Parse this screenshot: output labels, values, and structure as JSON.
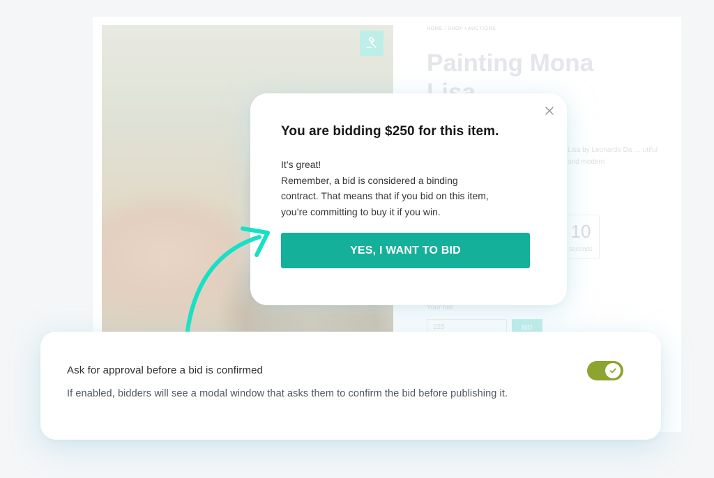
{
  "background_page": {
    "breadcrumb": "HOME / SHOP / AUCTIONS",
    "product_title": "Painting Mona Lisa",
    "description_fragment": "Lisa by Leonardo Da … utiful and modern",
    "timer": {
      "value": "10",
      "unit": "seconds"
    },
    "bid": {
      "label": "Your bid:",
      "input_value": "225",
      "button_label": "BID"
    }
  },
  "modal": {
    "title": "You are bidding $250 for this item.",
    "body_lines": [
      "It’s great!",
      "Remember, a bid is considered a binding",
      "contract. That means that if you bid on this item,",
      "you’re committing to buy it if you win."
    ],
    "confirm_button": "YES, I WANT TO BID",
    "close_icon": "close-icon"
  },
  "setting": {
    "title": "Ask for approval before a bid is confirmed",
    "description": "If enabled, bidders will see a modal window that asks them to confirm the bid before publishing it.",
    "enabled": true
  },
  "colors": {
    "accent": "#14b09a",
    "arrow": "#18e0c4",
    "toggle_on": "#8da52e"
  },
  "icons": {
    "gavel": "gavel-icon",
    "close": "close-icon",
    "check": "check-icon",
    "arrow": "curved-arrow"
  }
}
